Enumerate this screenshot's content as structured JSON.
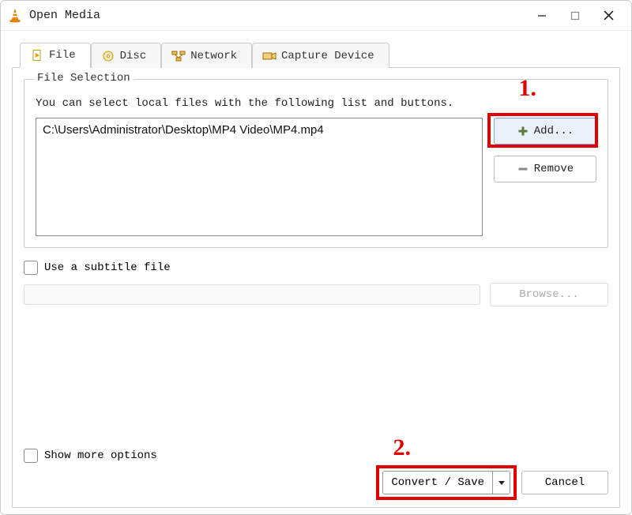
{
  "window": {
    "title": "Open Media"
  },
  "tabs": [
    {
      "label": "File"
    },
    {
      "label": "Disc"
    },
    {
      "label": "Network"
    },
    {
      "label": "Capture Device"
    }
  ],
  "file_selection": {
    "group_label": "File Selection",
    "instruction": "You can select local files with the following list and buttons.",
    "files": [
      "C:\\Users\\Administrator\\Desktop\\MP4 Video\\MP4.mp4"
    ],
    "add_label": "Add...",
    "remove_label": "Remove"
  },
  "subtitle": {
    "checkbox_label": "Use a subtitle file",
    "browse_label": "Browse..."
  },
  "bottom": {
    "show_more_label": "Show more options",
    "convert_label": "Convert / Save",
    "cancel_label": "Cancel"
  },
  "annotations": {
    "one": "1.",
    "two": "2."
  }
}
